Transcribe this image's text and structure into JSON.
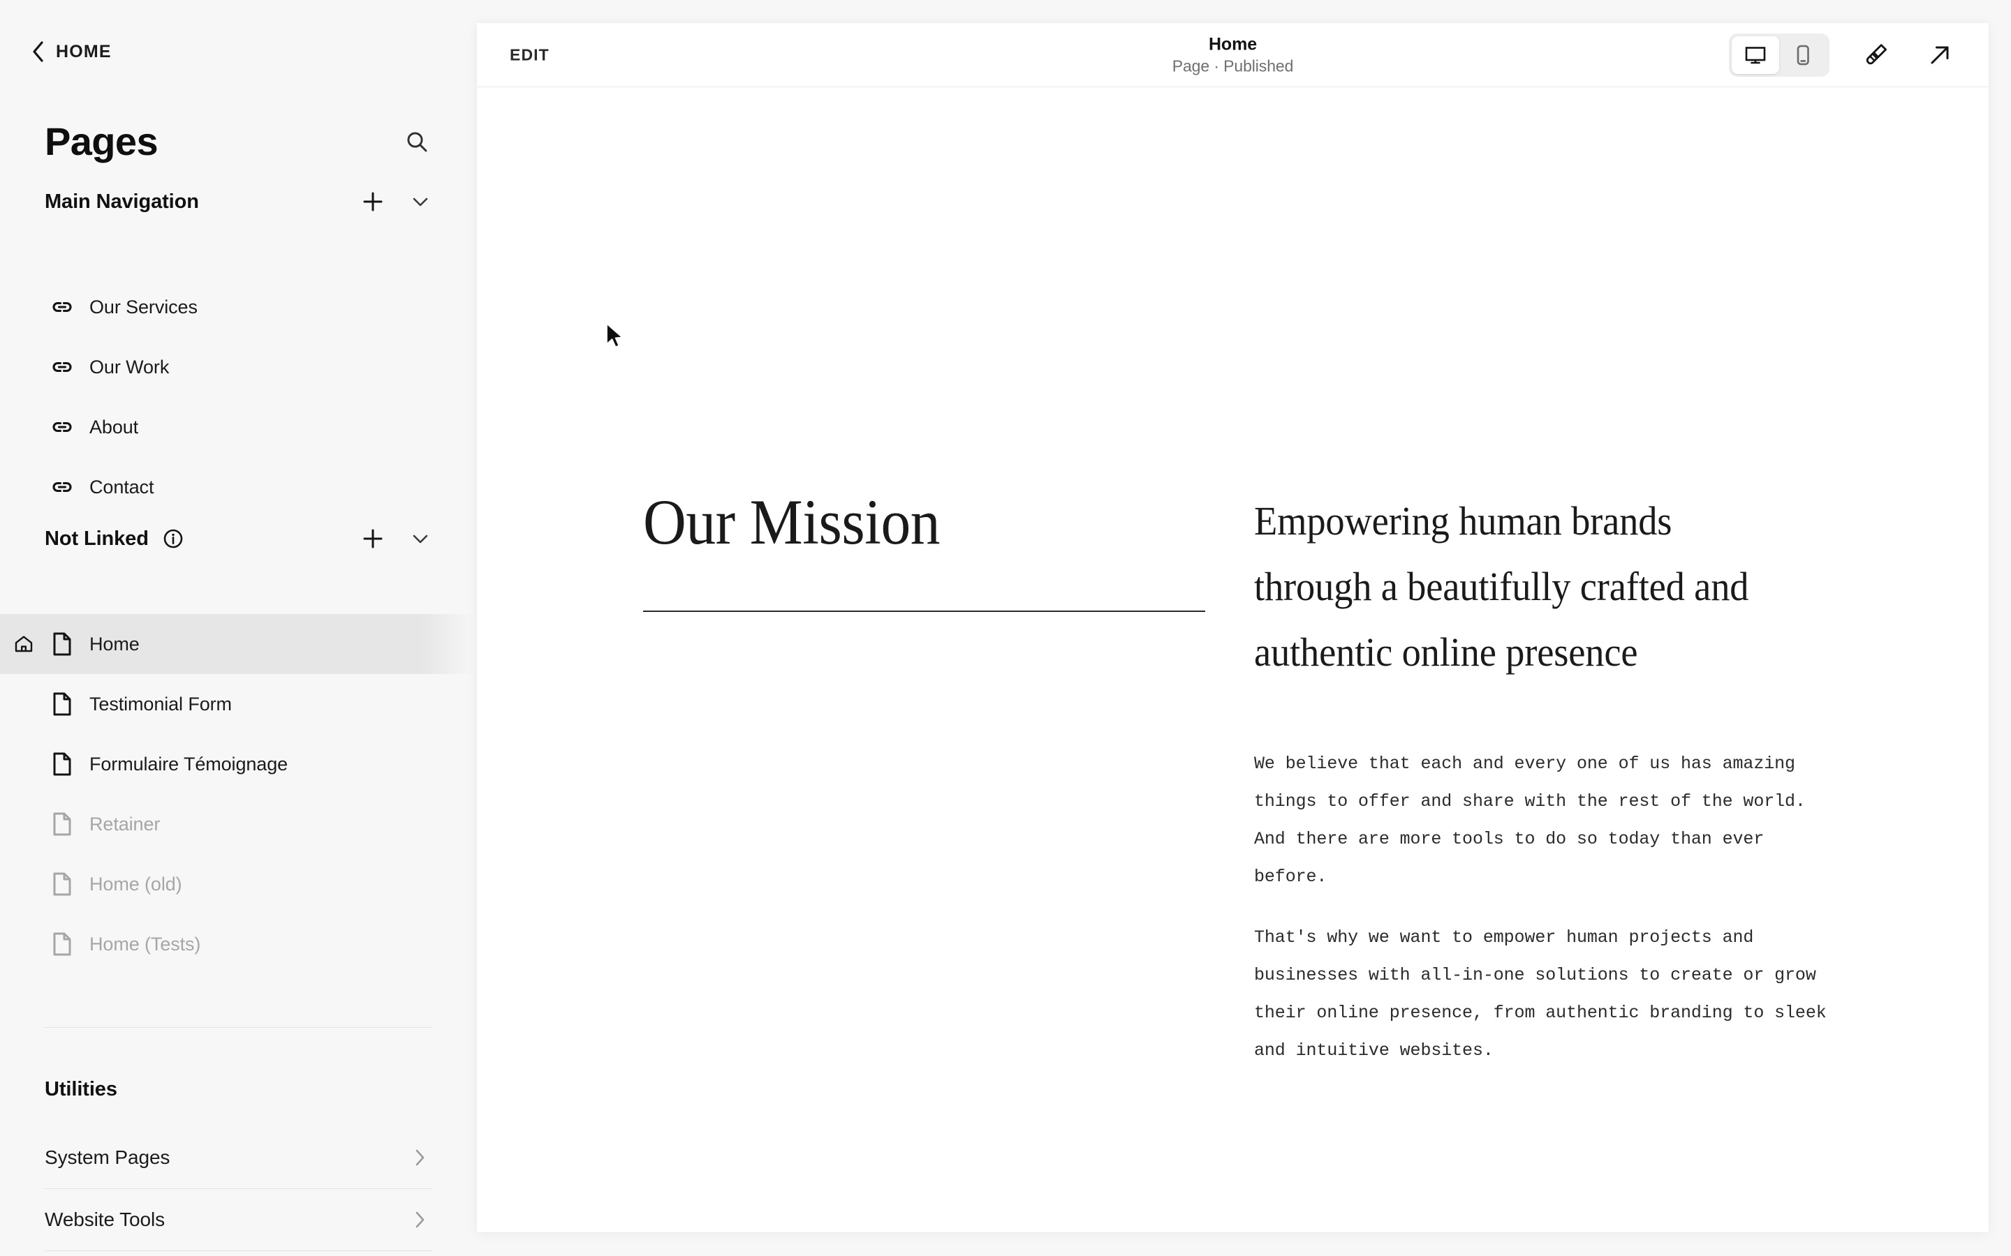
{
  "sidebar": {
    "back": {
      "label": "HOME",
      "icon": "chevron-left-icon"
    },
    "title": "Pages",
    "search_icon": "search-icon",
    "sections": [
      {
        "id": "main-navigation",
        "title": "Main Navigation",
        "add_icon": "plus-icon",
        "collapse_icon": "chevron-down-icon",
        "items": [
          {
            "label": "Our Services",
            "icon": "link-icon",
            "state": "normal"
          },
          {
            "label": "Our Work",
            "icon": "link-icon",
            "state": "normal"
          },
          {
            "label": "About",
            "icon": "link-icon",
            "state": "normal"
          },
          {
            "label": "Contact",
            "icon": "link-icon",
            "state": "normal"
          }
        ]
      },
      {
        "id": "not-linked",
        "title": "Not Linked",
        "info_icon": "info-icon",
        "add_icon": "plus-icon",
        "collapse_icon": "chevron-down-icon",
        "items": [
          {
            "label": "Home",
            "icon": "page-icon",
            "state": "selected",
            "leading_icon": "home-icon"
          },
          {
            "label": "Testimonial Form",
            "icon": "page-icon",
            "state": "normal"
          },
          {
            "label": "Formulaire Témoignage",
            "icon": "page-icon",
            "state": "normal"
          },
          {
            "label": "Retainer",
            "icon": "page-icon",
            "state": "disabled"
          },
          {
            "label": "Home (old)",
            "icon": "page-icon",
            "state": "disabled"
          },
          {
            "label": "Home (Tests)",
            "icon": "page-icon",
            "state": "disabled"
          }
        ]
      }
    ],
    "utilities": {
      "title": "Utilities",
      "rows": [
        {
          "label": "System Pages",
          "icon": "chevron-right-icon"
        },
        {
          "label": "Website Tools",
          "icon": "chevron-right-icon"
        }
      ]
    }
  },
  "toolbar": {
    "edit_label": "EDIT",
    "page_title": "Home",
    "page_status": "Page · Published",
    "view_modes": [
      {
        "name": "desktop",
        "icon": "desktop-icon",
        "active": true
      },
      {
        "name": "mobile",
        "icon": "mobile-icon",
        "active": false
      }
    ],
    "style_icon": "paintbrush-icon",
    "open_icon": "arrow-up-right-icon"
  },
  "page": {
    "section_title": "Our Mission",
    "lede": "Empowering human brands through a beautifully crafted and authentic online presence",
    "paragraphs": [
      "We believe that each and every one of us has amazing things to offer and share with the rest of the world. And there are more tools to do so today than ever before.",
      "That's why we want to empower human projects and businesses with all-in-one solutions to create or grow their online presence, from authentic branding to sleek and intuitive websites."
    ]
  },
  "colors": {
    "app_background": "#f7f7f7",
    "panel_background": "#ffffff",
    "selected_row": "#e6e6e6",
    "text_primary": "#1b1b1b",
    "text_muted": "#a6a6a6",
    "divider": "#e2e2e2"
  }
}
